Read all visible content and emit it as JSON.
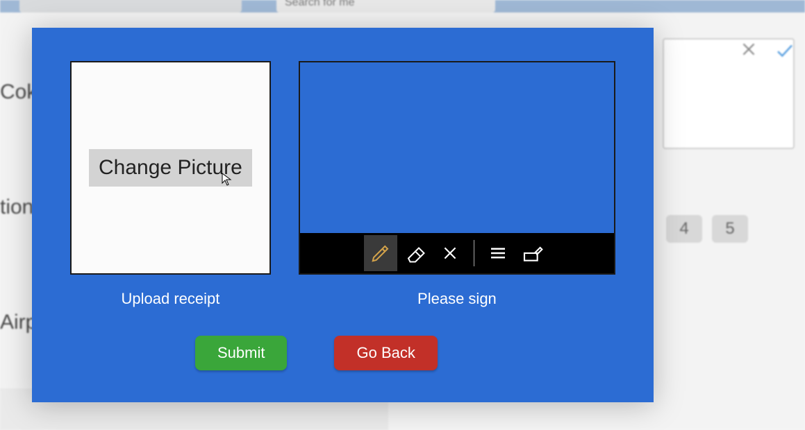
{
  "background": {
    "search_placeholder": "Search for me",
    "labels": [
      "Coke",
      "tion",
      "Airp"
    ],
    "badges": [
      "4",
      "5"
    ]
  },
  "modal": {
    "upload": {
      "change_button": "Change Picture",
      "caption": "Upload receipt"
    },
    "signature": {
      "caption": "Please sign",
      "toolbar": {
        "pen": "pen",
        "eraser": "eraser",
        "clear": "clear",
        "ruled": "ruled",
        "touch_write": "touch-write"
      }
    },
    "buttons": {
      "submit": "Submit",
      "go_back": "Go Back"
    }
  }
}
